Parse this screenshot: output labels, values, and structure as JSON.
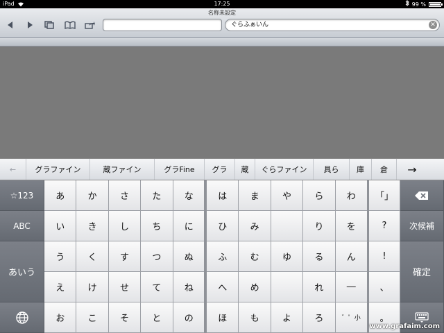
{
  "status": {
    "device": "iPad",
    "time": "17:25",
    "battery": "99 %",
    "battery_level": 0.99
  },
  "browser": {
    "title": "名称未設定",
    "address_value": "",
    "search_value": "ぐらふぁいん",
    "clear_symbol": "✕"
  },
  "candidates": {
    "back_arrow": "←",
    "items": [
      "グラファイン",
      "蔵ファイン",
      "グラFine",
      "グラ",
      "蔵",
      "ぐらファイン",
      "具ら",
      "庫",
      "倉"
    ],
    "more_arrow": "→"
  },
  "keyboard": {
    "left_keys": {
      "numbers": "☆123",
      "abc": "ABC",
      "kana": "あいう"
    },
    "left_group": [
      [
        "あ",
        "か",
        "さ",
        "た",
        "な"
      ],
      [
        "い",
        "き",
        "し",
        "ち",
        "に"
      ],
      [
        "う",
        "く",
        "す",
        "つ",
        "ぬ"
      ],
      [
        "え",
        "け",
        "せ",
        "て",
        "ね"
      ],
      [
        "お",
        "こ",
        "そ",
        "と",
        "の"
      ]
    ],
    "right_group": [
      [
        "は",
        "ま",
        "や",
        "ら",
        "わ"
      ],
      [
        "ひ",
        "み",
        "",
        "り",
        "を"
      ],
      [
        "ふ",
        "む",
        "ゆ",
        "る",
        "ん"
      ],
      [
        "へ",
        "め",
        "",
        "れ",
        "―"
      ],
      [
        "ほ",
        "も",
        "よ",
        "ろ",
        "゛゜小"
      ]
    ],
    "punct": [
      "「」",
      "?",
      "!",
      "、",
      "。"
    ],
    "right_keys": {
      "next": "次候補",
      "confirm": "確定"
    }
  },
  "watermark": "www.grafaim.com",
  "colors": {
    "page_bg": "#7a7a7a",
    "key_dark": "#6e727a",
    "key_light": "#f2f2f4"
  }
}
